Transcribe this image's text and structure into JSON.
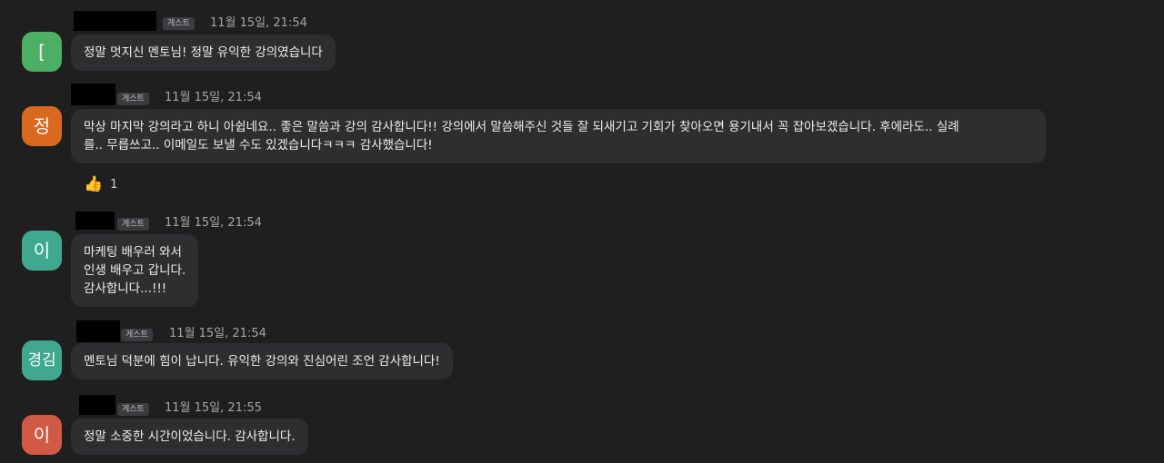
{
  "messages": [
    {
      "avatar_text": "[",
      "avatar_color": "#4caf63",
      "badge": "게스트",
      "time": "11월 15일, 21:54",
      "lines": [
        "정말 멋지신 멘토님! 정말 유익한 강의였습니다"
      ]
    },
    {
      "avatar_text": "정",
      "avatar_color": "#d9691f",
      "badge": "게스트",
      "time": "11월 15일, 21:54",
      "lines": [
        "막상 마지막 강의라고 하니 아쉽네요.. 좋은 말씀과 강의 감사합니다!! 강의에서 말씀해주신 것들 잘 되새기고 기회가 찾아오면 용기내서 꼭 잡아보겠습니다. 후에라도.. 실례",
        "를.. 무릅쓰고.. 이메일도 보낼 수도 있겠습니다ㅋㅋㅋ 감사했습니다!"
      ],
      "reaction": {
        "icon": "thumbs-up-icon",
        "emoji": "👍",
        "count": "1"
      }
    },
    {
      "avatar_text": "이",
      "avatar_color": "#3fa88f",
      "badge": "게스트",
      "time": "11월 15일, 21:54",
      "lines": [
        "마케팅 배우러 와서",
        "인생 배우고 갑니다.",
        "감사합니다...!!!"
      ]
    },
    {
      "avatar_text": "경김",
      "avatar_color": "#3fa88f",
      "badge": "게스트",
      "time": "11월 15일, 21:54",
      "lines": [
        "멘토님 덕분에 힘이 납니다. 유익한 강의와 진심어린 조언 감사합니다!"
      ]
    },
    {
      "avatar_text": "이",
      "avatar_color": "#d05a44",
      "badge": "게스트",
      "time": "11월 15일, 21:55",
      "lines": [
        "정말 소중한 시간이었습니다. 감사합니다."
      ]
    }
  ]
}
